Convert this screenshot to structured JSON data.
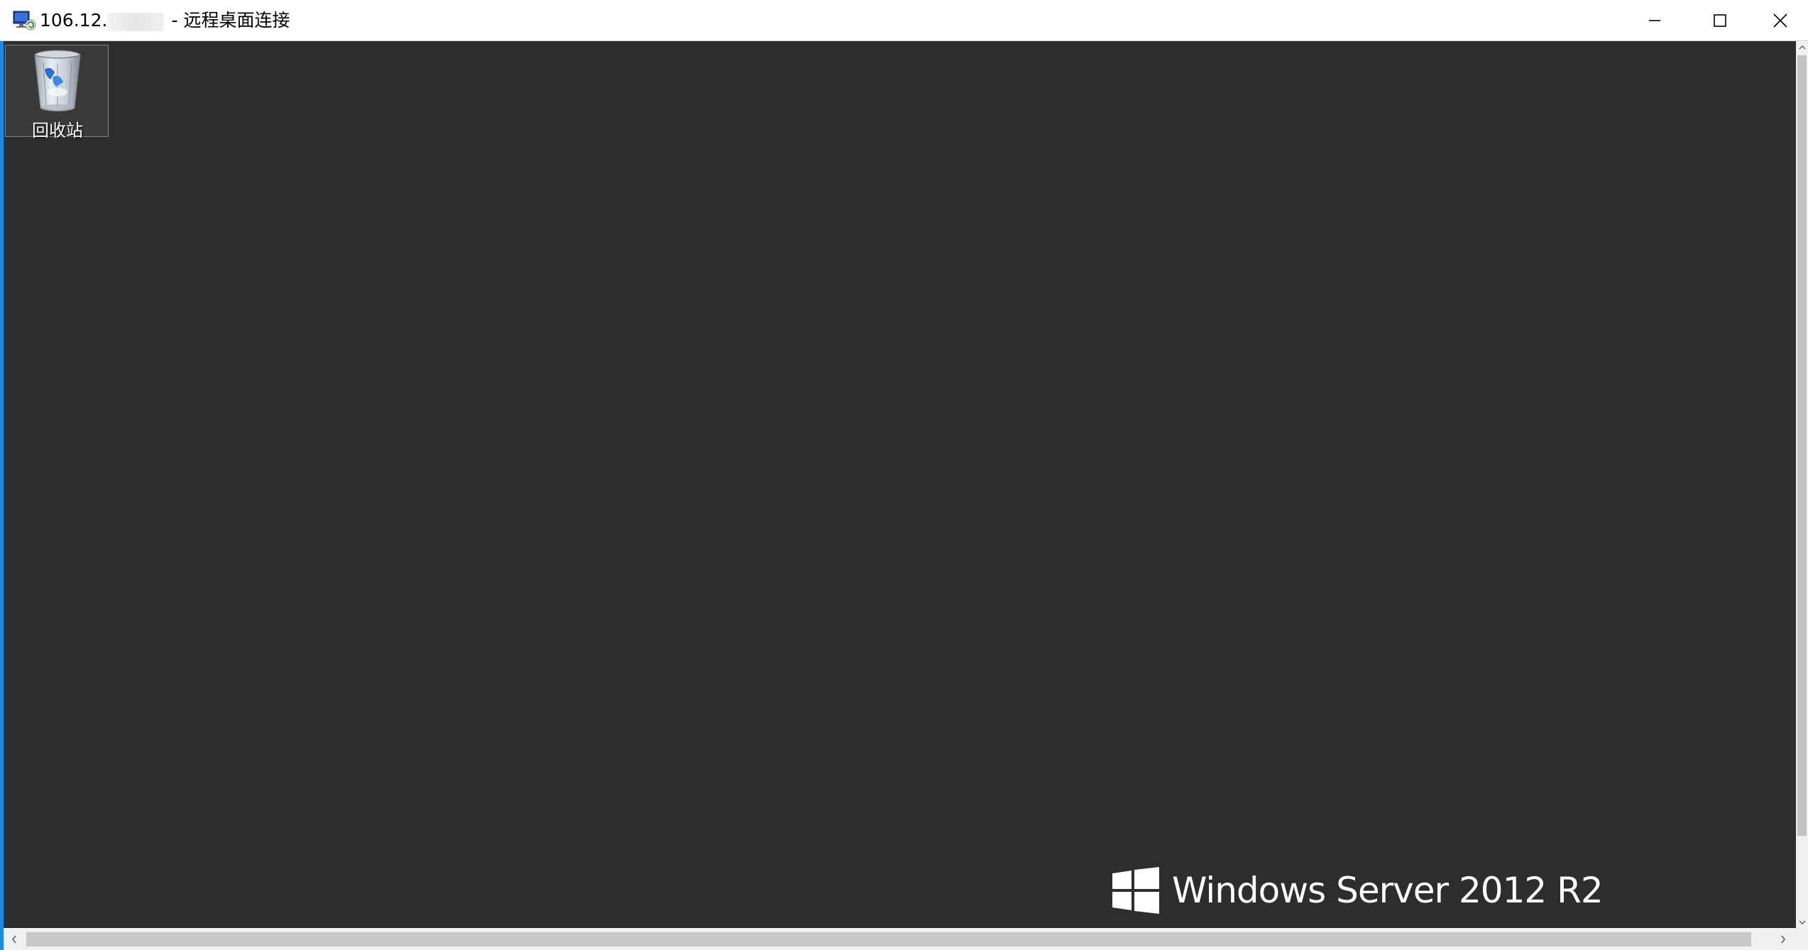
{
  "window": {
    "title_ip": "106.12.",
    "title_separator": "-",
    "title_app": "远程桌面连接",
    "icon": "remote-desktop-icon"
  },
  "controls": {
    "minimize_icon": "minimize-icon",
    "maximize_icon": "maximize-icon",
    "close_icon": "close-icon"
  },
  "desktop": {
    "background_color": "#2d2d2d",
    "icons": [
      {
        "label": "回收站",
        "icon": "recycle-bin-icon"
      }
    ],
    "branding": {
      "text": "Windows Server 2012 R2",
      "icon": "windows-logo-icon"
    }
  },
  "colors": {
    "active_border": "#1e88e5",
    "titlebar_bg": "#ffffff",
    "scrollbar_bg": "#f0f0f0"
  }
}
